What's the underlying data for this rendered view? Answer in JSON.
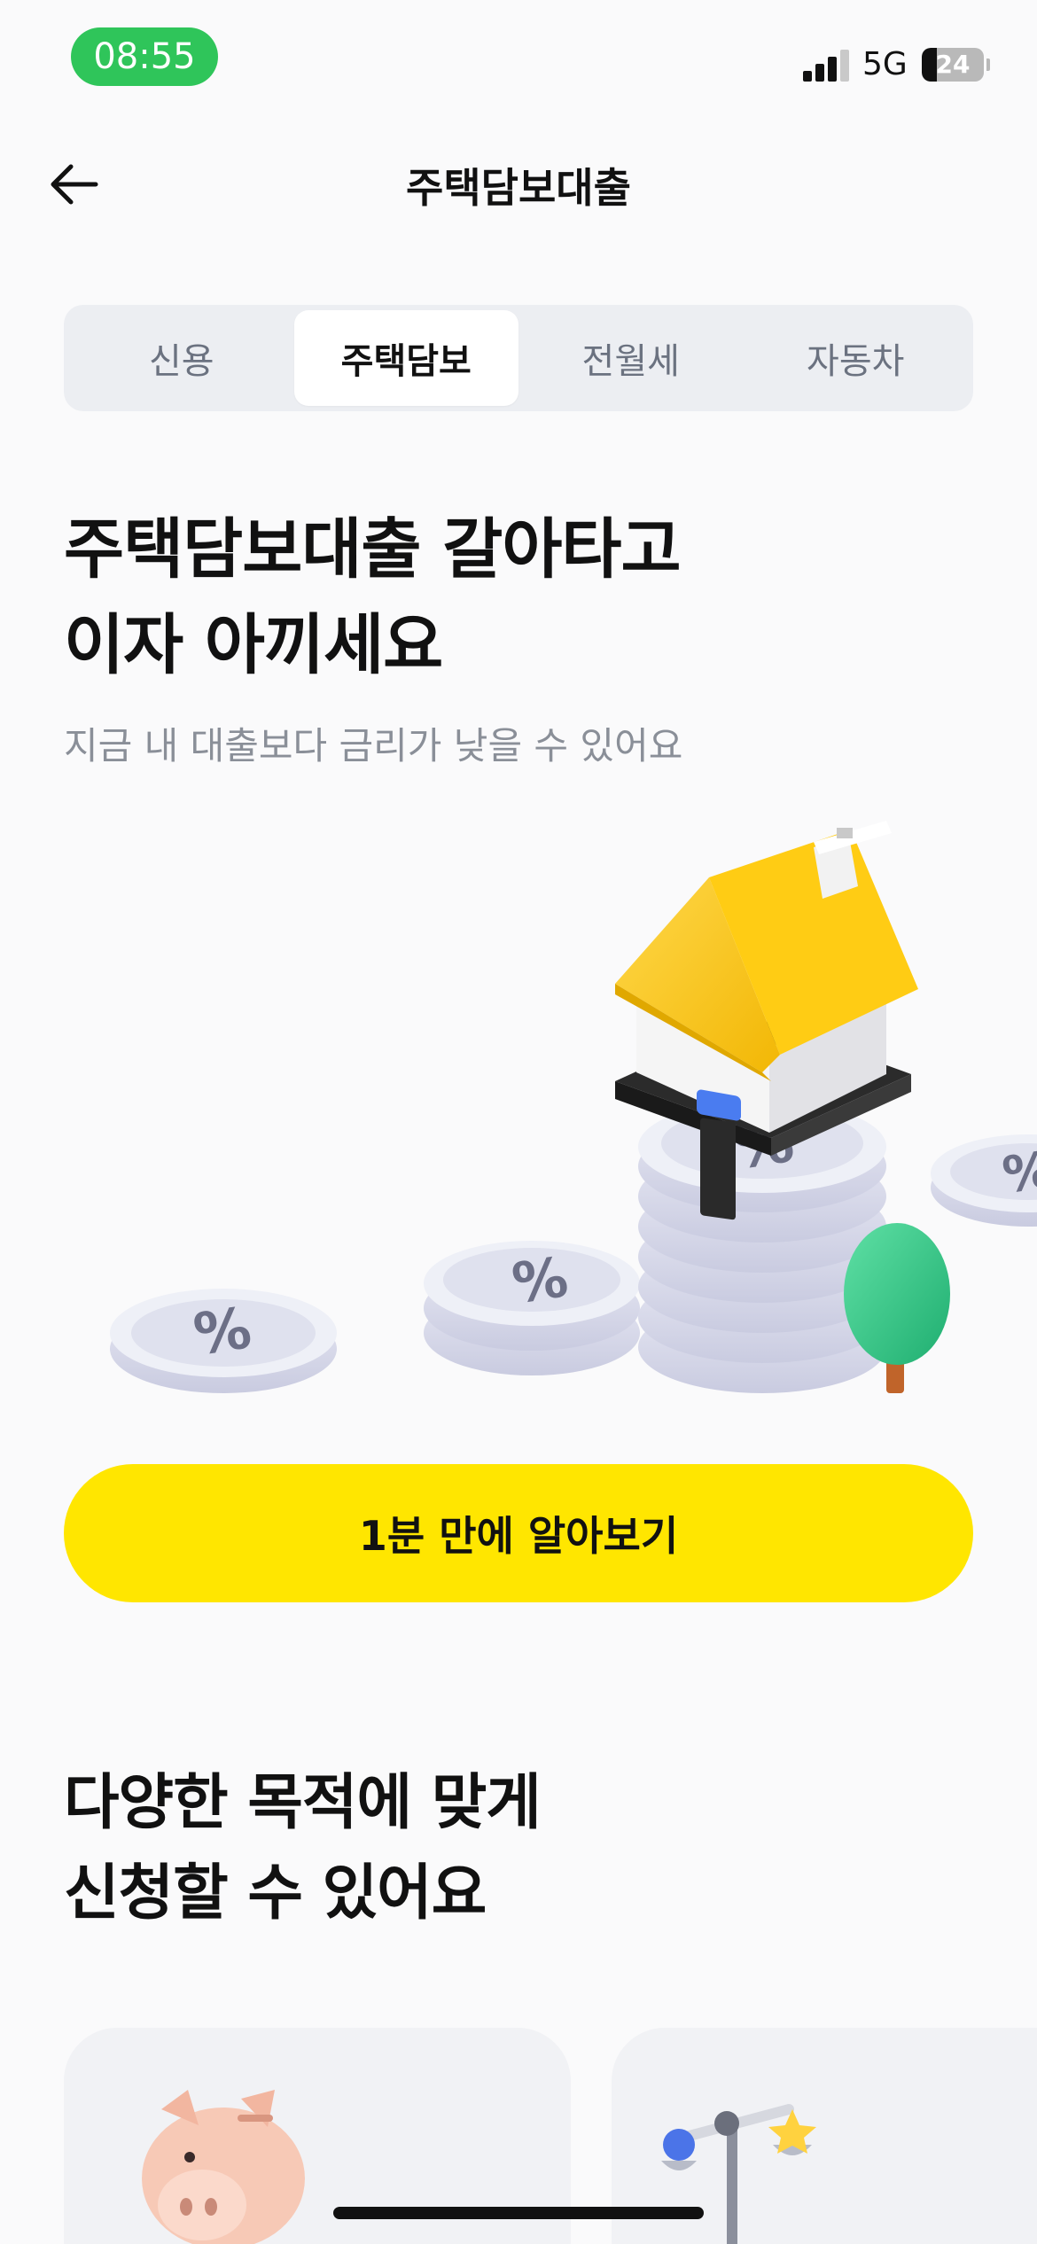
{
  "status_bar": {
    "time": "08:55",
    "network": "5G",
    "battery": "24",
    "battery_level": 0.24,
    "signal_icon": "signal-bars-icon",
    "battery_icon": "battery-icon"
  },
  "nav": {
    "title": "주택담보대출",
    "back_icon": "arrow-left-icon"
  },
  "tabs": [
    {
      "label": "신용",
      "active": false
    },
    {
      "label": "주택담보",
      "active": true
    },
    {
      "label": "전월세",
      "active": false
    },
    {
      "label": "자동차",
      "active": false
    }
  ],
  "hero": {
    "title_line1": "주택담보대출 갈아타고",
    "title_line2": "이자 아끼세요",
    "subtitle": "지금 내 대출보다 금리가 낮을 수 있어요",
    "illustration": "house-on-percent-coins-illustration",
    "coin_symbol": "%"
  },
  "cta": {
    "label": "1분 만에 알아보기"
  },
  "section": {
    "title_line1": "다양한 목적에 맞게",
    "title_line2": "신청할 수 있어요"
  },
  "cards": [
    {
      "icon": "piggy-bank-icon"
    },
    {
      "icon": "scale-balance-icon"
    }
  ],
  "colors": {
    "accent_yellow": "#ffe600",
    "time_pill_green": "#2fc55a",
    "tab_background": "#eceef2",
    "subtitle_gray": "#8a8f98",
    "background": "#fafafb"
  }
}
